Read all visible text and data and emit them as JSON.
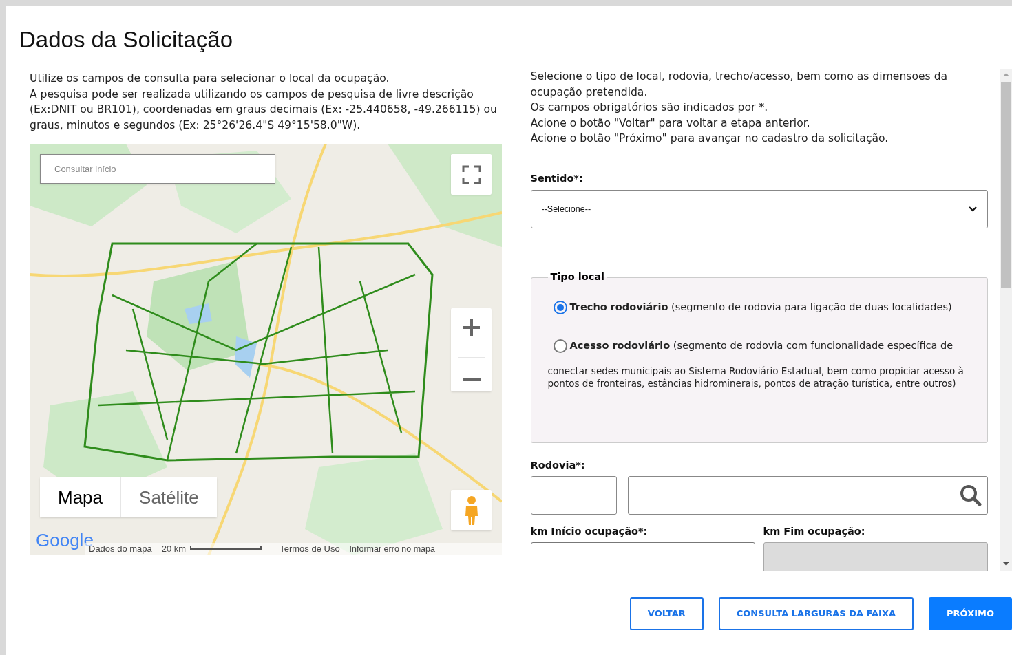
{
  "dialog": {
    "title": "Dados da Solicitação"
  },
  "intro": [
    "Utilize os campos de consulta para selecionar o local da ocupação.",
    "A pesquisa pode ser realizada utilizando os campos de pesquisa de livre descrição (Ex:DNIT ou BR101), coordenadas em graus decimais (Ex: -25.440658, -49.266115) ou graus, minutos e segundos (Ex: 25°26'26.4\"S 49°15'58.0\"W)."
  ],
  "map": {
    "search": {
      "placeholder": "Consultar início"
    },
    "map_types": [
      {
        "label": "Mapa",
        "selected": true
      },
      {
        "label": "Satélite",
        "selected": false
      }
    ],
    "logo": "Google",
    "footer": {
      "data": "Dados do mapa",
      "scale": "20 km",
      "terms": "Termos de Uso",
      "report": "Informar erro no mapa"
    }
  },
  "instructions": [
    "Selecione o tipo de local, rodovia, trecho/acesso, bem como as dimensões da ocupação pretendida.",
    "Os campos obrigatórios são indicados por *.",
    "Acione o botão \"Voltar\" para voltar a etapa anterior.",
    "Acione o botão \"Próximo\" para avançar no cadastro da solicitação."
  ],
  "direction": {
    "label": "Sentido*:",
    "value": "--Selecione--"
  },
  "location_type": {
    "legend": "Tipo local",
    "options": [
      {
        "title": "Trecho rodoviário",
        "description": "(segmento de rodovia para ligação de duas localidades)",
        "selected": true
      },
      {
        "title": "Acesso rodoviário",
        "description": "(segmento de rodovia com funcionalidade específica de",
        "continuation": "conectar sedes municipais ao Sistema Rodoviário Estadual, bem como propiciar acesso à pontos de fronteiras, estâncias hidrominerais, pontos de atração turística, entre outros)",
        "selected": false
      }
    ]
  },
  "road": {
    "label": "Rodovia*:"
  },
  "km_fields": [
    {
      "label": "km Início ocupação*:",
      "disabled": false
    },
    {
      "label": "km Fim ocupação:",
      "disabled": true
    }
  ],
  "buttons": [
    {
      "label": "VOLTAR",
      "kind": "outline"
    },
    {
      "label": "CONSULTA LARGURAS DA FAIXA",
      "kind": "outline"
    },
    {
      "label": "PRÓXIMO",
      "kind": "primary"
    }
  ]
}
